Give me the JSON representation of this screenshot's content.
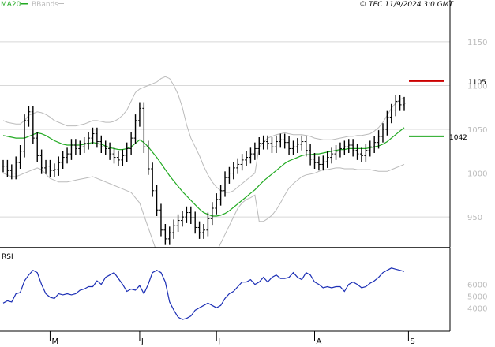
{
  "header": {
    "legend_ma": "MA20",
    "legend_bb": "BBands",
    "copyright": "© TEC 11/9/2024 3:0 GMT"
  },
  "colors": {
    "candles": "#000000",
    "ma": "#22aa22",
    "bbands": "#bbbbbb",
    "rsi": "#1c2fb5",
    "resistance": "#cc0000",
    "support": "#22aa22",
    "grid": "#d8d8d8",
    "frame": "#000000"
  },
  "chart_data": [
    {
      "type": "candlestick",
      "title": "",
      "ylim": [
        915,
        1185
      ],
      "y_ticks": [
        950,
        1000,
        1050,
        1100,
        1150
      ],
      "x_labels": [
        {
          "label": "M",
          "index": 11
        },
        {
          "label": "J",
          "index": 32
        },
        {
          "label": "J",
          "index": 50
        },
        {
          "label": "A",
          "index": 73
        },
        {
          "label": "S",
          "index": 95
        }
      ],
      "levels": [
        {
          "name": "resistance",
          "value": 1105,
          "label": "1105"
        },
        {
          "name": "support",
          "value": 1042,
          "label": "1042"
        }
      ],
      "close": [
        1008,
        1003,
        1000,
        1012,
        1025,
        1060,
        1070,
        1040,
        1020,
        1006,
        1008,
        1003,
        1004,
        1012,
        1018,
        1022,
        1032,
        1028,
        1030,
        1034,
        1040,
        1045,
        1036,
        1030,
        1028,
        1022,
        1018,
        1015,
        1020,
        1028,
        1040,
        1060,
        1074,
        1030,
        1005,
        980,
        958,
        935,
        925,
        932,
        940,
        946,
        950,
        955,
        949,
        938,
        932,
        935,
        948,
        960,
        970,
        980,
        995,
        1000,
        1006,
        1010,
        1015,
        1018,
        1022,
        1028,
        1034,
        1036,
        1034,
        1030,
        1036,
        1038,
        1035,
        1028,
        1030,
        1033,
        1036,
        1026,
        1016,
        1012,
        1010,
        1013,
        1018,
        1022,
        1025,
        1028,
        1030,
        1032,
        1026,
        1022,
        1020,
        1026,
        1030,
        1035,
        1042,
        1050,
        1064,
        1072,
        1082,
        1078,
        1080
      ],
      "ma20": [
        1043,
        1042,
        1041,
        1040,
        1040,
        1040,
        1042,
        1044,
        1046,
        1045,
        1043,
        1040,
        1037,
        1035,
        1033,
        1032,
        1032,
        1032,
        1032,
        1033,
        1034,
        1035,
        1034,
        1033,
        1031,
        1029,
        1028,
        1027,
        1027,
        1028,
        1030,
        1034,
        1038,
        1035,
        1030,
        1024,
        1018,
        1011,
        1004,
        997,
        991,
        985,
        979,
        974,
        969,
        964,
        959,
        955,
        953,
        951,
        951,
        952,
        954,
        957,
        961,
        965,
        969,
        973,
        977,
        981,
        986,
        991,
        995,
        999,
        1003,
        1007,
        1011,
        1014,
        1016,
        1018,
        1020,
        1021,
        1021,
        1022,
        1022,
        1023,
        1024,
        1025,
        1026,
        1027,
        1027,
        1028,
        1028,
        1028,
        1028,
        1028,
        1029,
        1030,
        1031,
        1033,
        1036,
        1040,
        1044,
        1048,
        1052
      ],
      "bb_upper": [
        1060,
        1058,
        1057,
        1056,
        1056,
        1060,
        1066,
        1068,
        1070,
        1069,
        1067,
        1064,
        1060,
        1058,
        1056,
        1054,
        1054,
        1054,
        1055,
        1056,
        1058,
        1060,
        1060,
        1059,
        1058,
        1058,
        1059,
        1062,
        1066,
        1072,
        1082,
        1092,
        1096,
        1098,
        1100,
        1102,
        1104,
        1108,
        1110,
        1108,
        1100,
        1090,
        1075,
        1055,
        1040,
        1030,
        1020,
        1008,
        998,
        990,
        984,
        980,
        978,
        978,
        980,
        984,
        988,
        992,
        996,
        1000,
        1030,
        1035,
        1040,
        1042,
        1044,
        1045,
        1046,
        1045,
        1044,
        1044,
        1044,
        1043,
        1042,
        1040,
        1039,
        1038,
        1038,
        1038,
        1039,
        1040,
        1041,
        1042,
        1042,
        1043,
        1043,
        1044,
        1045,
        1048,
        1052,
        1058,
        1066,
        1074,
        1080,
        1084,
        1086
      ],
      "bb_lower": [
        1000,
        998,
        996,
        996,
        998,
        1000,
        1002,
        1004,
        1006,
        1004,
        999,
        994,
        992,
        990,
        990,
        990,
        991,
        992,
        993,
        994,
        995,
        996,
        994,
        992,
        990,
        988,
        986,
        984,
        982,
        980,
        978,
        972,
        966,
        952,
        938,
        924,
        910,
        895,
        880,
        870,
        862,
        858,
        856,
        858,
        862,
        866,
        872,
        880,
        888,
        898,
        910,
        920,
        930,
        940,
        950,
        960,
        966,
        970,
        972,
        975,
        945,
        945,
        948,
        952,
        958,
        966,
        975,
        983,
        988,
        992,
        996,
        998,
        999,
        1000,
        1002,
        1004,
        1004,
        1005,
        1006,
        1006,
        1005,
        1005,
        1005,
        1004,
        1004,
        1004,
        1004,
        1003,
        1002,
        1002,
        1002,
        1004,
        1006,
        1008,
        1010
      ]
    },
    {
      "type": "line",
      "title": "RSI",
      "ylim": [
        20,
        90
      ],
      "y_ticks": [
        40,
        50,
        60
      ],
      "y_tick_labels": [
        "4000",
        "5000",
        "6000"
      ],
      "values": [
        44,
        46,
        45,
        52,
        53,
        63,
        68,
        72,
        70,
        60,
        52,
        49,
        48,
        52,
        51,
        52,
        51,
        52,
        55,
        56,
        58,
        58,
        63,
        60,
        66,
        68,
        70,
        65,
        60,
        54,
        56,
        55,
        59,
        52,
        60,
        70,
        72,
        70,
        62,
        45,
        38,
        32,
        30,
        31,
        33,
        38,
        40,
        42,
        44,
        42,
        40,
        42,
        48,
        52,
        54,
        58,
        62,
        62,
        64,
        60,
        62,
        66,
        62,
        66,
        68,
        65,
        65,
        66,
        70,
        66,
        64,
        70,
        68,
        62,
        60,
        57,
        58,
        57,
        58,
        58,
        54,
        60,
        62,
        60,
        57,
        58,
        61,
        63,
        66,
        70,
        72,
        74,
        73,
        72,
        71
      ]
    }
  ]
}
